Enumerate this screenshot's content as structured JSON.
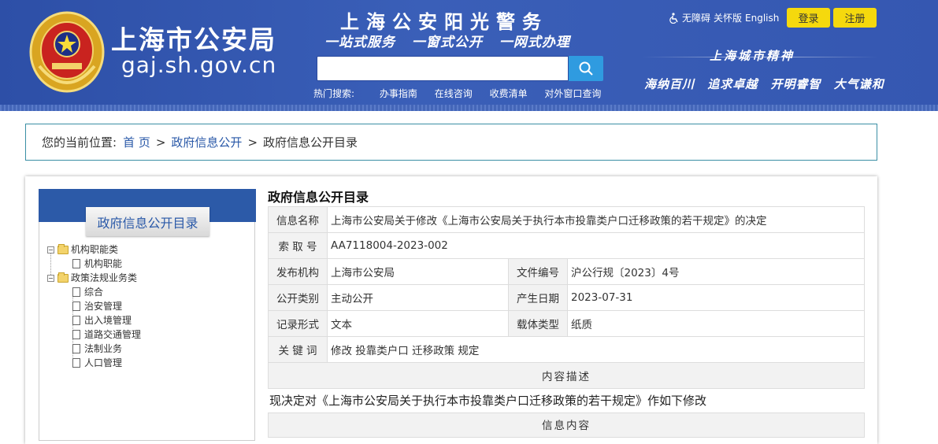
{
  "header": {
    "site_title": "上海市公安局",
    "site_url": "gaj.sh.gov.cn",
    "slogan_main": "上海公安阳光警务",
    "slogan_sub": [
      "一站式服务",
      "一窗式公开",
      "一网式办理"
    ],
    "accessibility": "无障碍",
    "care_version": "关怀版",
    "english": "English",
    "login": "登录",
    "register": "注册",
    "search": {
      "placeholder": ""
    },
    "hot_label": "热门搜索:",
    "hot_links": [
      "办事指南",
      "在线咨询",
      "收费清单",
      "对外窗口查询"
    ],
    "city_spirit": "上海城市精神",
    "city_words": [
      "海纳百川",
      "追求卓越",
      "开明睿智",
      "大气谦和"
    ]
  },
  "breadcrumb": {
    "prefix": "您的当前位置:",
    "items": [
      "首 页",
      "政府信息公开",
      "政府信息公开目录"
    ],
    "separator": ">"
  },
  "sidebar": {
    "title": "政府信息公开目录",
    "tree": [
      {
        "label": "机构职能类",
        "children": [
          "机构职能"
        ]
      },
      {
        "label": "政策法规业务类",
        "children": [
          "综合",
          "治安管理",
          "出入境管理",
          "道路交通管理",
          "法制业务",
          "人口管理"
        ]
      }
    ]
  },
  "content": {
    "title": "政府信息公开目录",
    "fields": {
      "info_name_label": "信息名称",
      "info_name": "上海市公安局关于修改《上海市公安局关于执行本市投靠类户口迁移政策的若干规定》的决定",
      "index_label": "索 取 号",
      "index": "AA7118004-2023-002",
      "publisher_label": "发布机构",
      "publisher": "上海市公安局",
      "doc_no_label": "文件编号",
      "doc_no": "沪公行规〔2023〕4号",
      "category_label": "公开类别",
      "category": "主动公开",
      "date_label": "产生日期",
      "date": "2023-07-31",
      "format_label": "记录形式",
      "format": "文本",
      "carrier_label": "载体类型",
      "carrier": "纸质",
      "keywords_label": "关 键 词",
      "keywords": "修改 投靠类户口 迁移政策 规定"
    },
    "desc_section": "内容描述",
    "description": "现决定对《上海市公安局关于执行本市投靠类户口迁移政策的若干规定》作如下修改",
    "info_section": "信息内容"
  },
  "colors": {
    "header_blue": "#3557b1",
    "link_blue": "#2a59a8",
    "button_yellow": "#f5d90d",
    "search_blue": "#2f9be0"
  }
}
